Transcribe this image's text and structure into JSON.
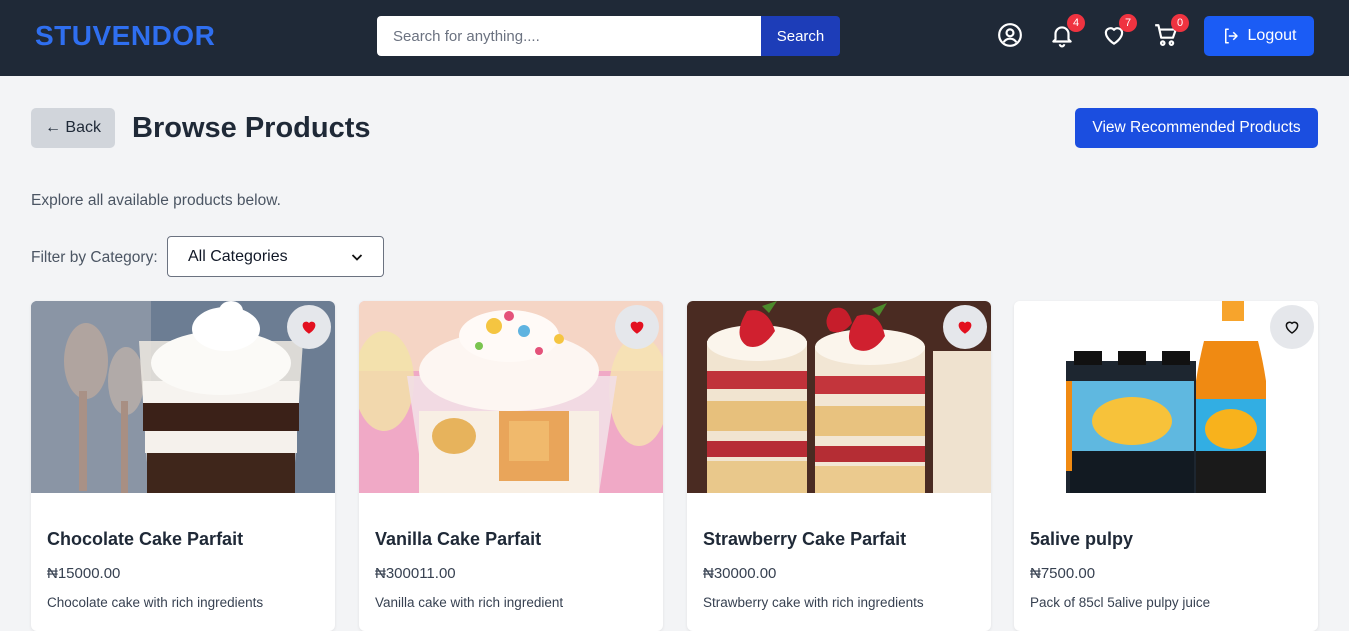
{
  "header": {
    "logo": "STUVENDOR",
    "search_placeholder": "Search for anything....",
    "search_button": "Search",
    "notifications_count": "4",
    "wishlist_count": "7",
    "cart_count": "0",
    "logout_label": "Logout"
  },
  "page": {
    "back_label": "← Back",
    "title": "Browse Products",
    "recommended_label": "View Recommended Products",
    "subtitle": "Explore all available products below.",
    "filter_label": "Filter by Category:",
    "filter_value": "All Categories"
  },
  "products": [
    {
      "name": "Chocolate Cake Parfait",
      "price": "₦15000.00",
      "description": "Chocolate cake with rich ingredients",
      "favorited": true
    },
    {
      "name": "Vanilla Cake Parfait",
      "price": "₦300011.00",
      "description": "Vanilla cake with rich ingredient",
      "favorited": true
    },
    {
      "name": "Strawberry Cake Parfait",
      "price": "₦30000.00",
      "description": "Strawberry cake with rich ingredients",
      "favorited": true
    },
    {
      "name": "5alive pulpy",
      "price": "₦7500.00",
      "description": "Pack of 85cl 5alive pulpy juice",
      "favorited": false
    }
  ],
  "colors": {
    "header_bg": "#1f2937",
    "brand": "#2f6ff0",
    "primary_button": "#1b5cf5",
    "badge": "#ef3340",
    "favorite_active": "#e3101f"
  }
}
